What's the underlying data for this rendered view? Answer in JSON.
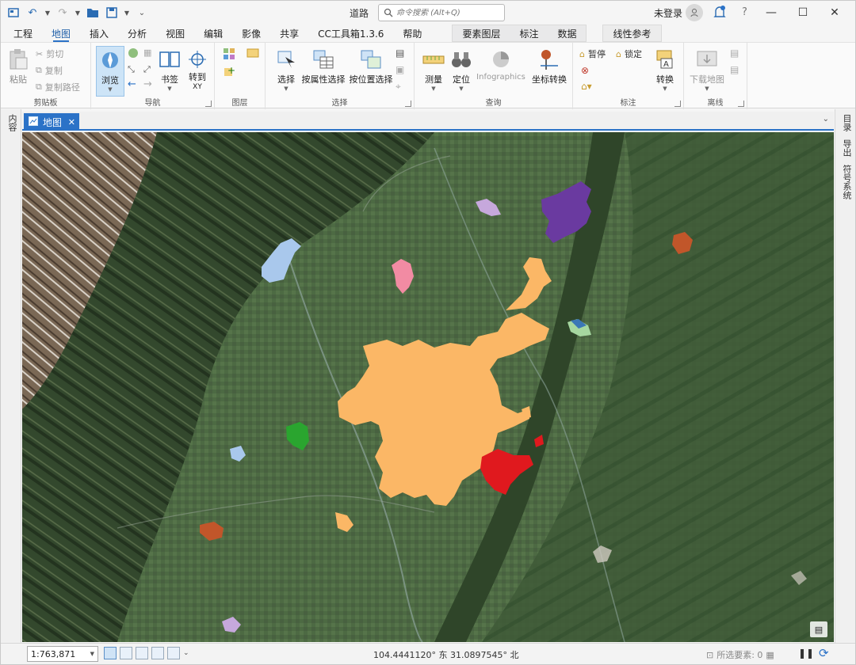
{
  "title_bar": {
    "title": "道路",
    "search_placeholder": "命令搜索 (Alt+Q)",
    "signin": "未登录",
    "help": "?"
  },
  "tabs": [
    "工程",
    "地图",
    "插入",
    "分析",
    "视图",
    "编辑",
    "影像",
    "共享",
    "CC工具箱1.3.6",
    "帮助"
  ],
  "context_tabs": [
    "要素图层",
    "标注",
    "数据"
  ],
  "context_tab_extra": "线性参考",
  "ribbon": {
    "clipboard": {
      "paste": "粘贴",
      "cut": "剪切",
      "copy": "复制",
      "copy_path": "复制路径",
      "label": "剪贴板"
    },
    "navigate": {
      "explore": "浏览",
      "bookmarks": "书签",
      "goto_xy": "转到",
      "goto_xy_sub": "XY",
      "label": "导航"
    },
    "layer": {
      "label": "图层"
    },
    "selection": {
      "select": "选择",
      "by_attr": "按属性选择",
      "by_loc": "按位置选择",
      "label": "选择"
    },
    "inquiry": {
      "measure": "测量",
      "locate": "定位",
      "infographics": "Infographics",
      "coord": "坐标转换",
      "label": "查询"
    },
    "labeling": {
      "pause": "暂停",
      "lock": "锁定",
      "convert": "转换",
      "label": "标注"
    },
    "offline": {
      "download": "下载地图",
      "label": "离线"
    }
  },
  "left_pane": "内容",
  "right_pane": [
    "目录",
    "导出",
    "符号系统"
  ],
  "view_tab": {
    "label": "地图"
  },
  "status_bar": {
    "scale": "1:763,871",
    "coordinates": "104.4441120° 东 31.0897545° 北",
    "selected_features": "所选要素: 0"
  },
  "colors": {
    "accent": "#2b72c7",
    "urban_core": "#fbb766",
    "purple_area": "#6a3aa0",
    "red_area": "#e0191e",
    "green_area": "#2aa52f",
    "pink_area": "#f28ba3",
    "brown_area": "#c1562a",
    "lightblue_area": "#a9c8ec",
    "lavender_area": "#c6a8dc"
  }
}
